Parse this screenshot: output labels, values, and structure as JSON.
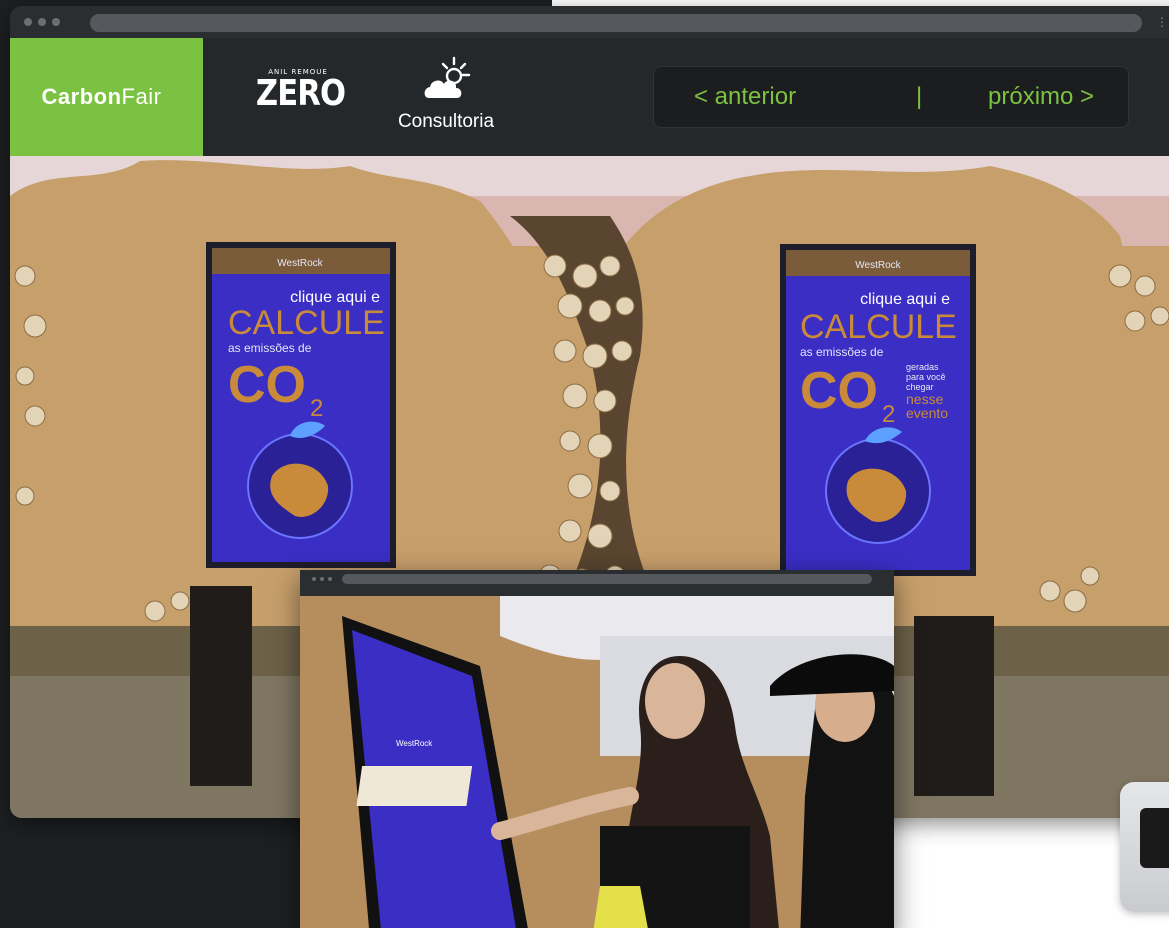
{
  "header": {
    "brand_left_bold": "Carbon",
    "brand_left_light": "Fair",
    "brand_zero_small": "ANIL REMOUE",
    "brand_zero": "ZERO",
    "brand_consultoria": "Consultoria"
  },
  "pager": {
    "prev_label": "< anterior",
    "separator": "|",
    "next_label": "próximo >"
  },
  "hero_signs": {
    "brand": "WestRock",
    "line1": "clique aqui e",
    "line2": "CALCULE",
    "line3": "as emissões de",
    "line4_left": "geradas",
    "line4b": "para você",
    "line4c": "chegar",
    "co2": "CO",
    "co2_sub": "2",
    "tail1": "nesse",
    "tail2": "evento"
  },
  "colors": {
    "accent": "#7cc242",
    "chrome": "#25282b",
    "screen_blue": "#3a2ec4",
    "cardboard": "#c79f6b"
  }
}
